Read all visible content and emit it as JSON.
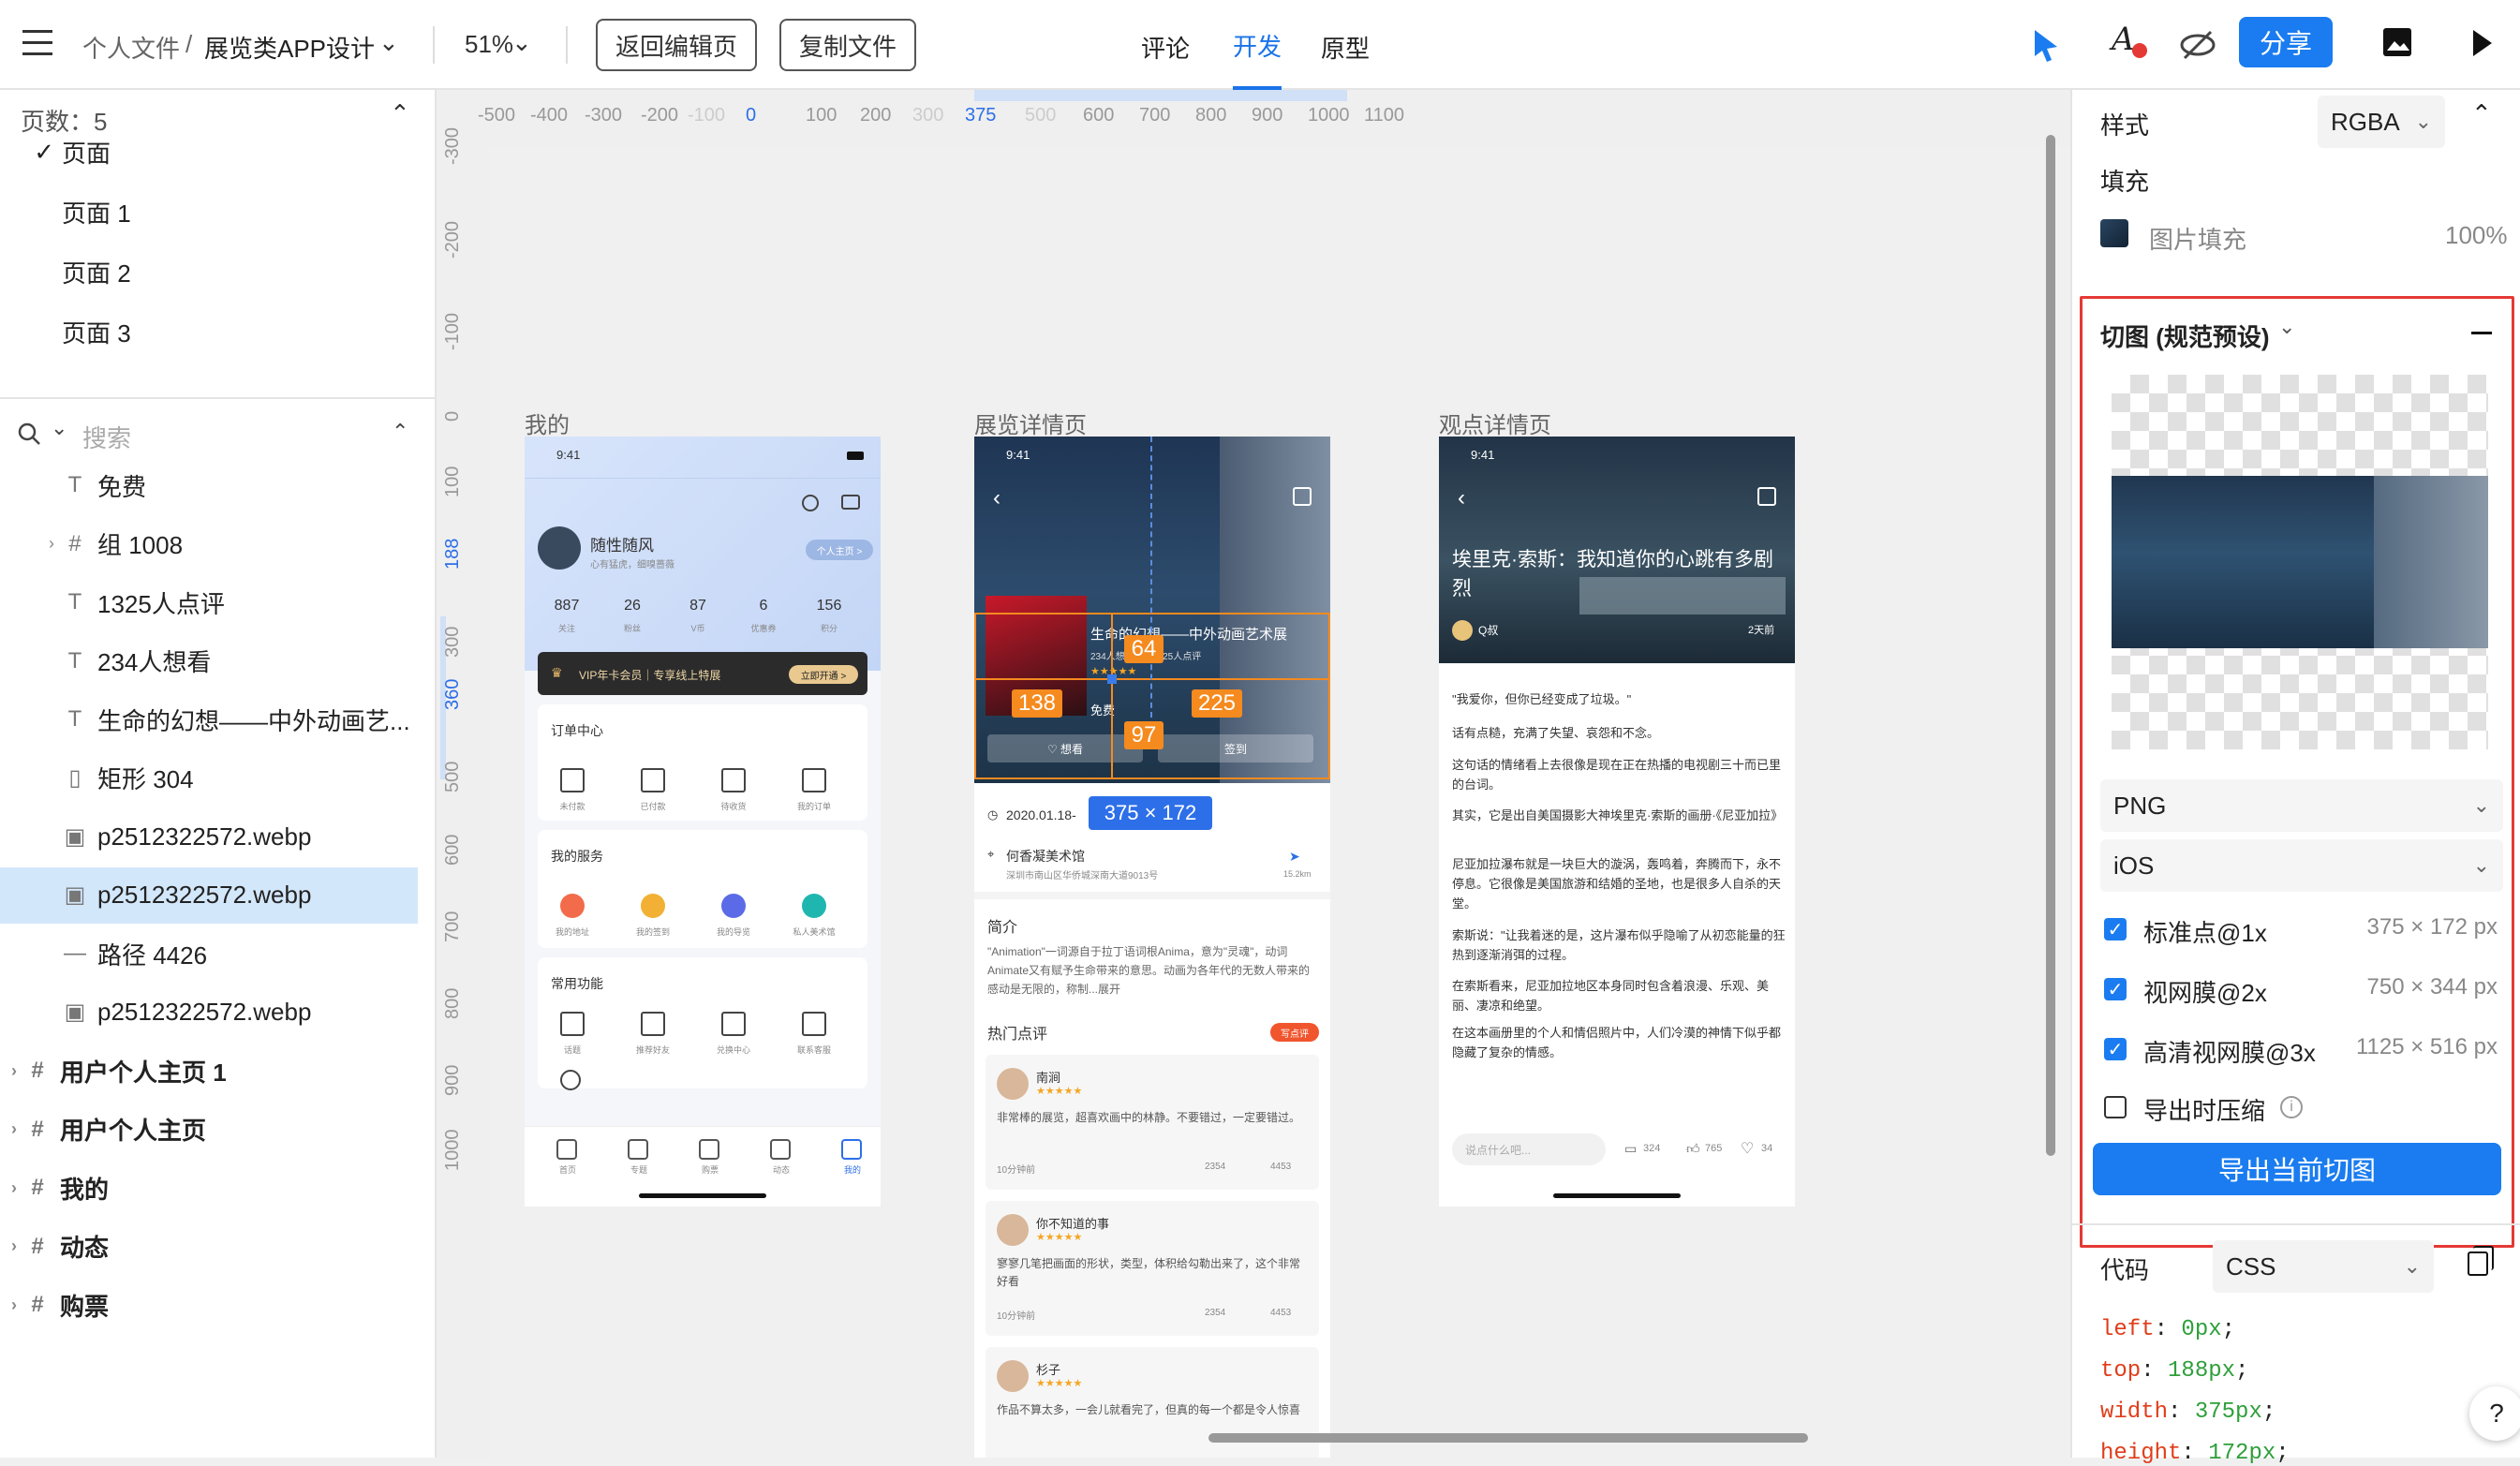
{
  "topbar": {
    "breadcrumb_root": "个人文件",
    "breadcrumb_sep": "/",
    "project": "展览类APP设计",
    "zoom": "51%",
    "back_edit": "返回编辑页",
    "copy_file": "复制文件",
    "tabs": [
      "评论",
      "开发",
      "原型"
    ],
    "active_tab": "开发",
    "share": "分享"
  },
  "left": {
    "pages_title": "页数：5",
    "pages": [
      "页面",
      "页面 1",
      "页面 2",
      "页面 3"
    ],
    "search_placeholder": "搜索",
    "layers": [
      {
        "icon": "T",
        "label": "免费"
      },
      {
        "icon": "frame",
        "label": "组 1008"
      },
      {
        "icon": "T",
        "label": "1325人点评"
      },
      {
        "icon": "T",
        "label": "234人想看"
      },
      {
        "icon": "T",
        "label": "生命的幻想——中外动画艺..."
      },
      {
        "icon": "rect",
        "label": "矩形 304"
      },
      {
        "icon": "img",
        "label": "p2512322572.webp"
      },
      {
        "icon": "img",
        "label": "p2512322572.webp"
      },
      {
        "icon": "line",
        "label": "路径 4426"
      },
      {
        "icon": "img",
        "label": "p2512322572.webp"
      },
      {
        "icon": "frame",
        "label": "用户个人主页 1"
      },
      {
        "icon": "frame",
        "label": "用户个人主页"
      },
      {
        "icon": "frame",
        "label": "我的"
      },
      {
        "icon": "frame",
        "label": "动态"
      },
      {
        "icon": "frame",
        "label": "购票"
      }
    ]
  },
  "canvas": {
    "ruler_h": [
      "-500",
      "-400",
      "-300",
      "-200",
      "-100",
      "0",
      "100",
      "200",
      "300",
      "375",
      "500",
      "600",
      "700",
      "800",
      "900",
      "1000",
      "1100"
    ],
    "ruler_v": [
      "-300",
      "-200",
      "-100",
      "0",
      "100",
      "188",
      "300",
      "360",
      "500",
      "600",
      "700",
      "800",
      "900",
      "1000"
    ],
    "frames": [
      "我的",
      "展览详情页",
      "观点详情页"
    ],
    "measure": {
      "w": "64",
      "left": "138",
      "right": "225",
      "bottom": "97",
      "size": "375 × 172"
    },
    "mine": {
      "time": "9:41",
      "user": "随性随风",
      "sub": "心有猛虎，细嗅蔷薇",
      "homepage": "个人主页 >",
      "stats": [
        {
          "n": "887",
          "l": "关注"
        },
        {
          "n": "26",
          "l": "粉丝"
        },
        {
          "n": "87",
          "l": "V币"
        },
        {
          "n": "6",
          "l": "优惠券"
        },
        {
          "n": "156",
          "l": "积分"
        }
      ],
      "vip": "VIP年卡会员｜专享线上特展",
      "vip_btn": "立即开通 >",
      "orders": "订单中心",
      "order_items": [
        "未付款",
        "已付款",
        "待收货",
        "我的订单"
      ],
      "services": "我的服务",
      "service_items": [
        "我的地址",
        "我的签到",
        "我的导览",
        "私人美术馆"
      ],
      "common": "常用功能",
      "common_items": [
        "话题",
        "推荐好友",
        "兑换中心",
        "联系客服"
      ],
      "tabbar": [
        "首页",
        "专题",
        "购票",
        "动态",
        "我的"
      ]
    },
    "exhibit": {
      "time": "9:41",
      "title": "生命的幻想——中外动画艺术展",
      "want": "234人想看",
      "reviews": "1325人点评",
      "free": "免费",
      "want_btn": "♡ 想看",
      "sign_btn": "签到",
      "date": "2020.01.18-",
      "venue": "何香凝美术馆",
      "addr": "深圳市南山区华侨城深南大道9013号",
      "dist": "15.2km",
      "intro_title": "简介",
      "intro": "\"Animation\"一词源自于拉丁语词根Anima，意为\"灵魂\"，动词Animate又有赋予生命带来的意思。动画为各年代的无数人带来的感动是无限的，称制...展开",
      "hot": "热门点评",
      "write": "写点评",
      "comments": [
        {
          "name": "南涧",
          "text": "非常棒的展览，超喜欢画中的林静。不要错过，一定要错过。",
          "time": "10分钟前",
          "c": "2354",
          "l": "4453"
        },
        {
          "name": "你不知道的事",
          "text": "寥寥几笔把画面的形状，类型，体积给勾勒出来了，这个非常好看",
          "time": "10分钟前",
          "c": "2354",
          "l": "4453"
        },
        {
          "name": "杉子",
          "text": "作品不算太多，一会儿就看完了，但真的每一个都是令人惊喜",
          "time": "",
          "c": "",
          "l": ""
        }
      ]
    },
    "view": {
      "time": "9:41",
      "title": "埃里克·索斯：我知道你的心跳有多剧烈",
      "author": "Q叔",
      "ago": "2天前",
      "paras": [
        "\"我爱你，但你已经变成了垃圾。\"",
        "话有点糙，充满了失望、哀怨和不念。",
        "这句话的情绪看上去很像是现在正在热播的电视剧三十而已里的台词。",
        "其实，它是出自美国摄影大神埃里克·索斯的画册·《尼亚加拉》",
        "尼亚加拉瀑布就是一块巨大的漩涡，轰鸣着，奔腾而下，永不停息。它很像是美国旅游和结婚的圣地，也是很多人自杀的天堂。",
        "索斯说：\"让我着迷的是，这片瀑布似乎隐喻了从初恋能量的狂热到逐渐消弭的过程。",
        "在索斯看来，尼亚加拉地区本身同时包含着浪漫、乐观、美丽、凄凉和绝望。",
        "在这本画册里的个人和情侣照片中，人们冷漠的神情下似乎都隐藏了复杂的情感。"
      ],
      "input": "说点什么吧...",
      "c": "324",
      "l": "765",
      "f": "34"
    }
  },
  "right": {
    "style_label": "样式",
    "color_mode": "RGBA",
    "fill_label": "填充",
    "fill_type": "图片填充",
    "fill_opacity": "100%",
    "slice_title": "切图 (规范预设)",
    "format": "PNG",
    "platform": "iOS",
    "exports": [
      {
        "label": "标准点@1x",
        "size": "375 × 172 px",
        "checked": true
      },
      {
        "label": "视网膜@2x",
        "size": "750 × 344 px",
        "checked": true
      },
      {
        "label": "高清视网膜@3x",
        "size": "1125 × 516 px",
        "checked": true
      }
    ],
    "compress": "导出时压缩",
    "export_btn": "导出当前切图",
    "code_label": "代码",
    "code_lang": "CSS",
    "code": [
      {
        "k": "left",
        "v": "0px"
      },
      {
        "k": "top",
        "v": "188px"
      },
      {
        "k": "width",
        "v": "375px"
      },
      {
        "k": "height",
        "v": "172px"
      }
    ],
    "help": "?"
  },
  "colors": {
    "accent": "#1a7cf0",
    "slice_border": "#e53935",
    "measure": "#f58a1f"
  }
}
